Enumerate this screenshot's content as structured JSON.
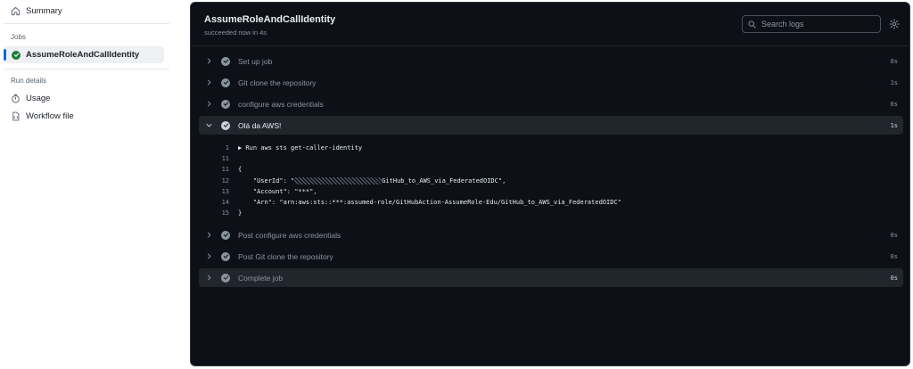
{
  "sidebar": {
    "summary_label": "Summary",
    "jobs_heading": "Jobs",
    "job_label": "AssumeRoleAndCallIdentity",
    "run_details_heading": "Run details",
    "usage_label": "Usage",
    "workflow_file_label": "Workflow file"
  },
  "main": {
    "title": "AssumeRoleAndCallIdentity",
    "subtitle": "succeeded now in 4s",
    "search_placeholder": "Search logs"
  },
  "steps": [
    {
      "name": "Set up job",
      "duration": "0s"
    },
    {
      "name": "Git clone the repository",
      "duration": "1s"
    },
    {
      "name": "configure aws credentials",
      "duration": "0s"
    },
    {
      "name": "Olá da AWS!",
      "duration": "1s"
    },
    {
      "name": "Post configure aws credentials",
      "duration": "0s"
    },
    {
      "name": "Post Git clone the repository",
      "duration": "0s"
    },
    {
      "name": "Complete job",
      "duration": "0s"
    }
  ],
  "log": [
    {
      "num": "1",
      "text": "▶ Run aws sts get-caller-identity"
    },
    {
      "num": "11",
      "text": ""
    },
    {
      "num": "11",
      "text": "{"
    },
    {
      "num": "12",
      "prefix": "    \"UserId\": \"",
      "suffix": "GitHub_to_AWS_via_FederatedOIDC\","
    },
    {
      "num": "13",
      "text": "    \"Account\": \"***\","
    },
    {
      "num": "14",
      "text": "    \"Arn\": \"arn:aws:sts::***:assumed-role/GitHubAction-AssumeRole-Edu/GitHub_to_AWS_via_FederatedOIDC\""
    },
    {
      "num": "15",
      "text": "}"
    }
  ],
  "colors": {
    "success_green": "#1a7f37",
    "active_accent": "#0969da",
    "panel_bg": "#0d1117"
  }
}
